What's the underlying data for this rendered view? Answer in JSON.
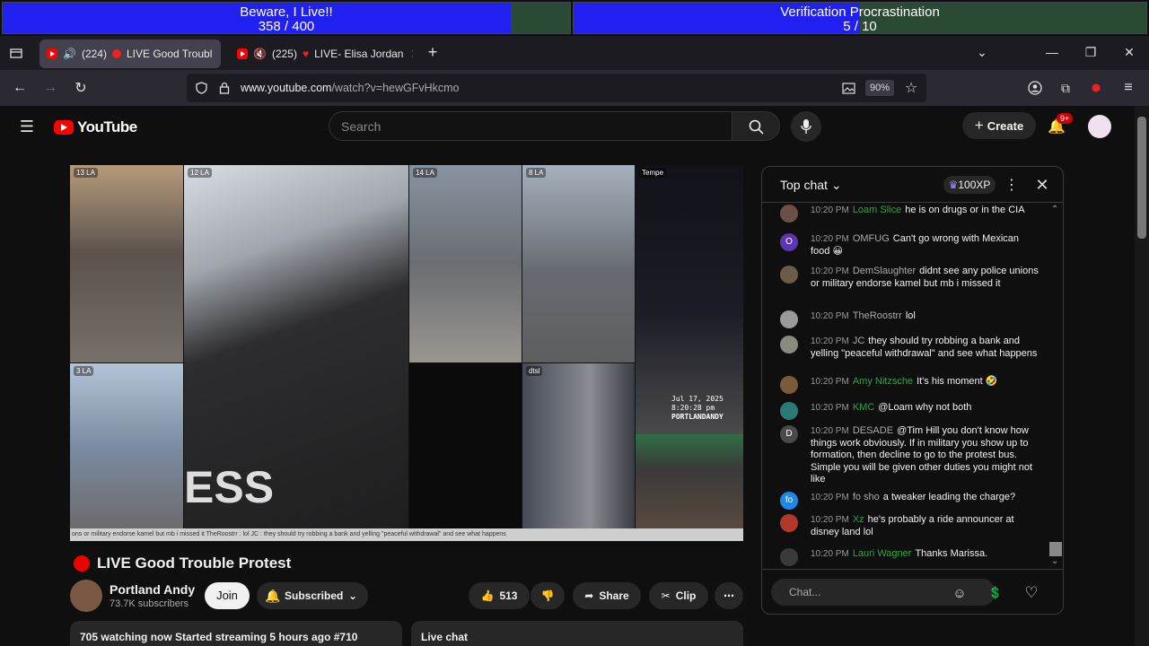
{
  "overlay": {
    "bar1": {
      "title": "Beware, I Live!!",
      "count": "358 / 400",
      "progress": 0.895
    },
    "bar2": {
      "title": "Verification Procrastination",
      "count": "5 / 10",
      "progress": 0.5
    }
  },
  "browser": {
    "tabs": [
      {
        "title": "(224)",
        "title2": "LIVE Good Troubl",
        "active": true
      },
      {
        "title": "(225)",
        "title2": "LIVE- Elisa Jordan",
        "active": false
      }
    ],
    "url_domain": "www.youtube.com",
    "url_path": "/watch?v=hewGFvHkcmo",
    "zoom": "90%"
  },
  "youtube": {
    "logo": "YouTube",
    "search_placeholder": "Search",
    "create_label": "Create",
    "notif_badge": "9+"
  },
  "video": {
    "cells": [
      {
        "label": "13 LA",
        "color": "#6c6258"
      },
      {
        "label": "12 LA",
        "color": "#3a3838"
      },
      {
        "label": "14 LA",
        "color": "#8a8f99"
      },
      {
        "label": "8 LA",
        "color": "#7b7c80"
      },
      {
        "label": "Tempe",
        "color": "#181822"
      },
      {
        "label": "3 LA",
        "color": "#8e9cb0"
      },
      {
        "label": "dtsl",
        "color": "#6b6e76"
      }
    ],
    "overlay_date": "Jul 17, 2025",
    "overlay_time": "8:20:28 pm",
    "overlay_channel": "PORTLANDANDY",
    "ticker": "ons or military endorse kamel but mb i missed it   TheRoostrr : lol   JC : they should try robbing a bank and yelling \"peaceful withdrawal\" and see what happens"
  },
  "meta": {
    "title": "LIVE Good Trouble Protest",
    "channel": "Portland Andy",
    "subs": "73.7K subscribers",
    "join": "Join",
    "subscribed": "Subscribed",
    "likes": "513",
    "share": "Share",
    "clip": "Clip",
    "description": "705 watching now  Started streaming 5 hours ago  #710",
    "live_chat": "Live chat"
  },
  "chat": {
    "header": "Top chat",
    "xp": "100XP",
    "input_placeholder": "Chat...",
    "messages": [
      {
        "ts": "10:20 PM",
        "author": "Loam Slice",
        "author_color": "green",
        "text": "he is on drugs or in the CIA",
        "avatar": "",
        "avatar_color": "#6b5046"
      },
      {
        "ts": "10:20 PM",
        "author": "OMFUG",
        "author_color": "grey",
        "text": "Can't go wrong with Mexican food 😀",
        "avatar": "O",
        "avatar_color": "#5e35b1"
      },
      {
        "ts": "10:20 PM",
        "author": "DemSlaughter",
        "author_color": "grey",
        "text": "didnt see any police unions or military endorse kamel but mb i missed it",
        "avatar": "",
        "avatar_color": "#6d5a48"
      },
      {
        "ts": "10:20 PM",
        "author": "TheRoostrr",
        "author_color": "grey",
        "text": "lol",
        "avatar": "",
        "avatar_color": "#9a9a9a"
      },
      {
        "ts": "10:20 PM",
        "author": "JC",
        "author_color": "grey",
        "text": "they should try robbing a bank and yelling \"peaceful withdrawal\" and see what happens",
        "avatar": "",
        "avatar_color": "#8a8a80"
      },
      {
        "ts": "10:20 PM",
        "author": "Amy Nitzsche",
        "author_color": "green",
        "text": "It's his moment 🤣",
        "avatar": "",
        "avatar_color": "#7a5a3a"
      },
      {
        "ts": "10:20 PM",
        "author": "KMC",
        "author_color": "green",
        "text": "@Loam why not both",
        "avatar": "",
        "avatar_color": "#2b7a78"
      },
      {
        "ts": "10:20 PM",
        "author": "DESADE",
        "author_color": "grey",
        "text": "@Tim Hill you don't know how things work obviously. If in military you show up to formation, then decline to go to the protest bus. Simple you will be given other duties you might not like",
        "avatar": "D",
        "avatar_color": "#4a4a4a"
      },
      {
        "ts": "10:20 PM",
        "author": "fo sho",
        "author_color": "grey",
        "text": "a tweaker leading the charge?",
        "avatar": "fo",
        "avatar_color": "#1e88e5"
      },
      {
        "ts": "10:20 PM",
        "author": "Xz",
        "author_color": "green",
        "text": "he's probably a ride announcer at disney land lol",
        "avatar": "",
        "avatar_color": "#b0392b"
      },
      {
        "ts": "10:20 PM",
        "author": "Lauri Wagner",
        "author_color": "green",
        "text": "Thanks Marissa.",
        "avatar": "",
        "avatar_color": "#3a3a3a"
      }
    ]
  }
}
